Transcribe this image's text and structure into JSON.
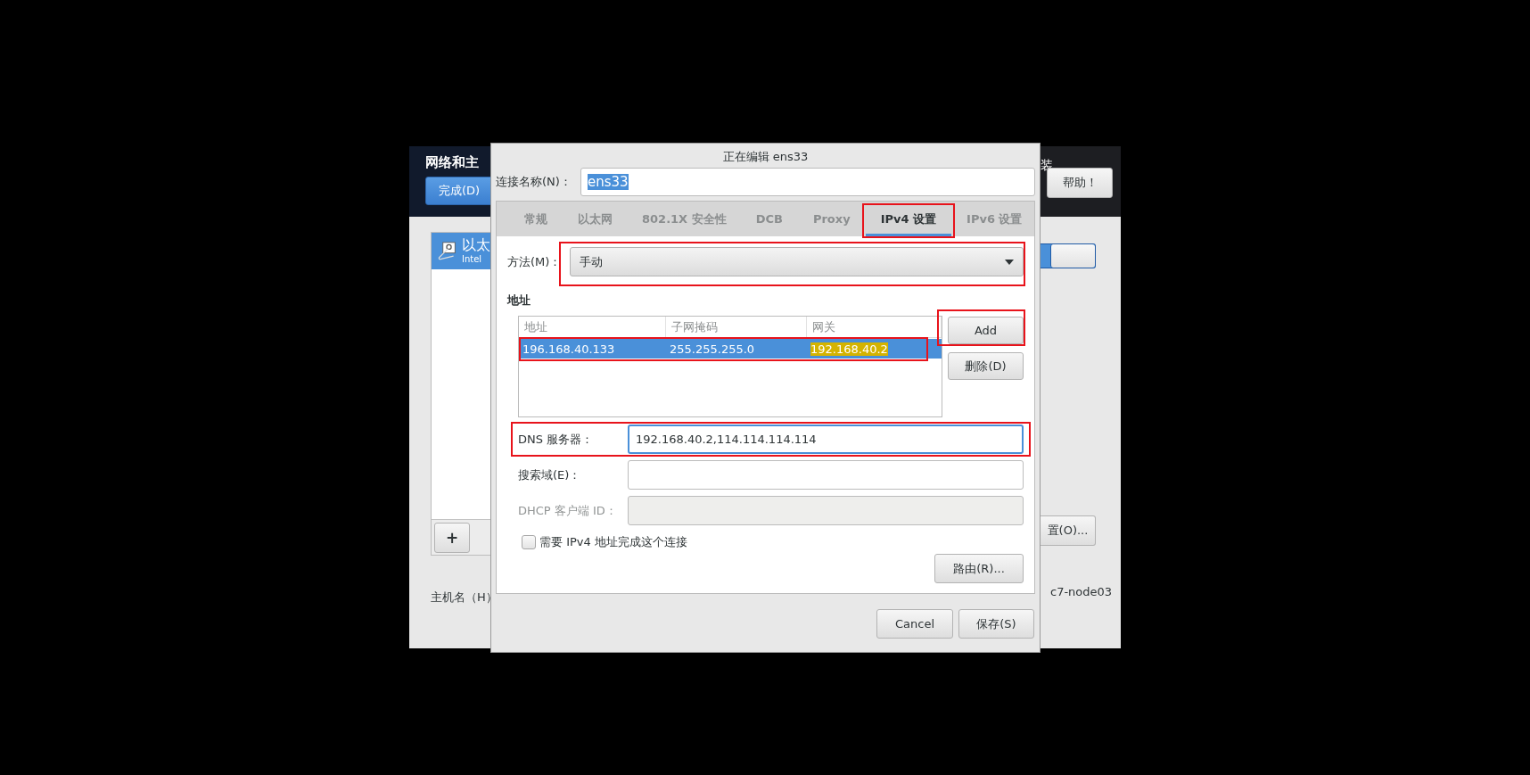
{
  "background_window": {
    "title": "网络和主",
    "header_fragment": "装",
    "done_button": "完成(D)",
    "help_button": "帮助！",
    "device_item": {
      "name": "以太",
      "subtitle": "Intel",
      "selected": true
    },
    "list_buttons": [
      "+"
    ],
    "toggle": {
      "on": true
    },
    "configure_button": "置(O)...",
    "hostname_label": "主机名（H）",
    "hostname_value": "c7-node03"
  },
  "dialog": {
    "title": "正在编辑 ens33",
    "connection_name": {
      "label": "连接名称(N)：",
      "value": "ens33",
      "value_selected": true
    },
    "tabs": [
      {
        "label": "常规",
        "selected": false,
        "highlighted": false
      },
      {
        "label": "以太网",
        "selected": false,
        "highlighted": false
      },
      {
        "label": "802.1X 安全性",
        "selected": false,
        "highlighted": false
      },
      {
        "label": "DCB",
        "selected": false,
        "highlighted": false
      },
      {
        "label": "Proxy",
        "selected": false,
        "highlighted": false
      },
      {
        "label": "IPv4 设置",
        "selected": true,
        "highlighted": true
      },
      {
        "label": "IPv6 设置",
        "selected": false,
        "highlighted": false
      }
    ],
    "method": {
      "label": "方法(M)：",
      "value": "手动",
      "highlighted": true
    },
    "addresses": {
      "title": "地址",
      "columns": [
        "地址",
        "子网掩码",
        "网关"
      ],
      "rows": [
        {
          "cells": [
            {
              "text": "196.168.40.133",
              "marked": false
            },
            {
              "text": "255.255.255.0",
              "marked": false
            },
            {
              "text": "192.168.40.2",
              "marked": true
            }
          ],
          "selected": true,
          "highlighted": true
        }
      ],
      "buttons": [
        {
          "label": "Add",
          "highlighted": true
        },
        {
          "label": "删除(D)",
          "highlighted": false
        }
      ]
    },
    "fields": [
      {
        "label": "DNS 服务器：",
        "value": "192.168.40.2,114.114.114.114",
        "focused": true,
        "disabled": false,
        "highlighted": true
      },
      {
        "label": "搜索域(E)：",
        "focused": false,
        "disabled": false,
        "highlighted": false
      },
      {
        "label": "DHCP 客户端 ID：",
        "focused": false,
        "disabled": true,
        "highlighted": false
      }
    ],
    "require_checkbox": {
      "label": "需要 IPv4 地址完成这个连接",
      "checked": false
    },
    "routes_button": "路由(R)...",
    "footer_buttons": [
      "Cancel",
      "保存(S)"
    ]
  }
}
